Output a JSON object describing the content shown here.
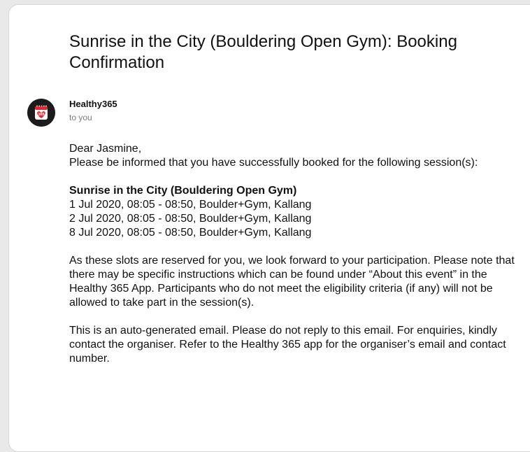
{
  "email": {
    "subject": "Sunrise in the City (Bouldering Open Gym): Booking Confirmation",
    "sender": {
      "name": "Healthy365",
      "recipient_label": "to you",
      "avatar_icon": "healthy365-calendar-heart-icon",
      "avatar_text": "365",
      "avatar_bg": "#1c1c1c",
      "avatar_accent": "#e5262e"
    },
    "body": {
      "greeting": "Dear Jasmine,",
      "intro": "Please be informed that you have successfully booked for the following session(s):",
      "session_title": "Sunrise in the City (Bouldering Open Gym)",
      "sessions": [
        "1 Jul 2020, 08:05 - 08:50, Boulder+Gym, Kallang",
        "2 Jul 2020, 08:05 - 08:50, Boulder+Gym, Kallang",
        "8 Jul 2020, 08:05 - 08:50, Boulder+Gym, Kallang"
      ],
      "paragraph_instructions": "As these slots are reserved for you, we look forward to your participation. Please note that there may be specific instructions which can be found under “About this event” in the Healthy 365 App. Participants who do not meet the eligibility criteria (if any) will not be allowed to take part in the session(s).",
      "paragraph_footer": "This is an auto-generated email. Please do not reply to this email. For enquiries, kindly contact the organiser. Refer to the Healthy 365 app for the organiser’s email and contact number."
    }
  }
}
